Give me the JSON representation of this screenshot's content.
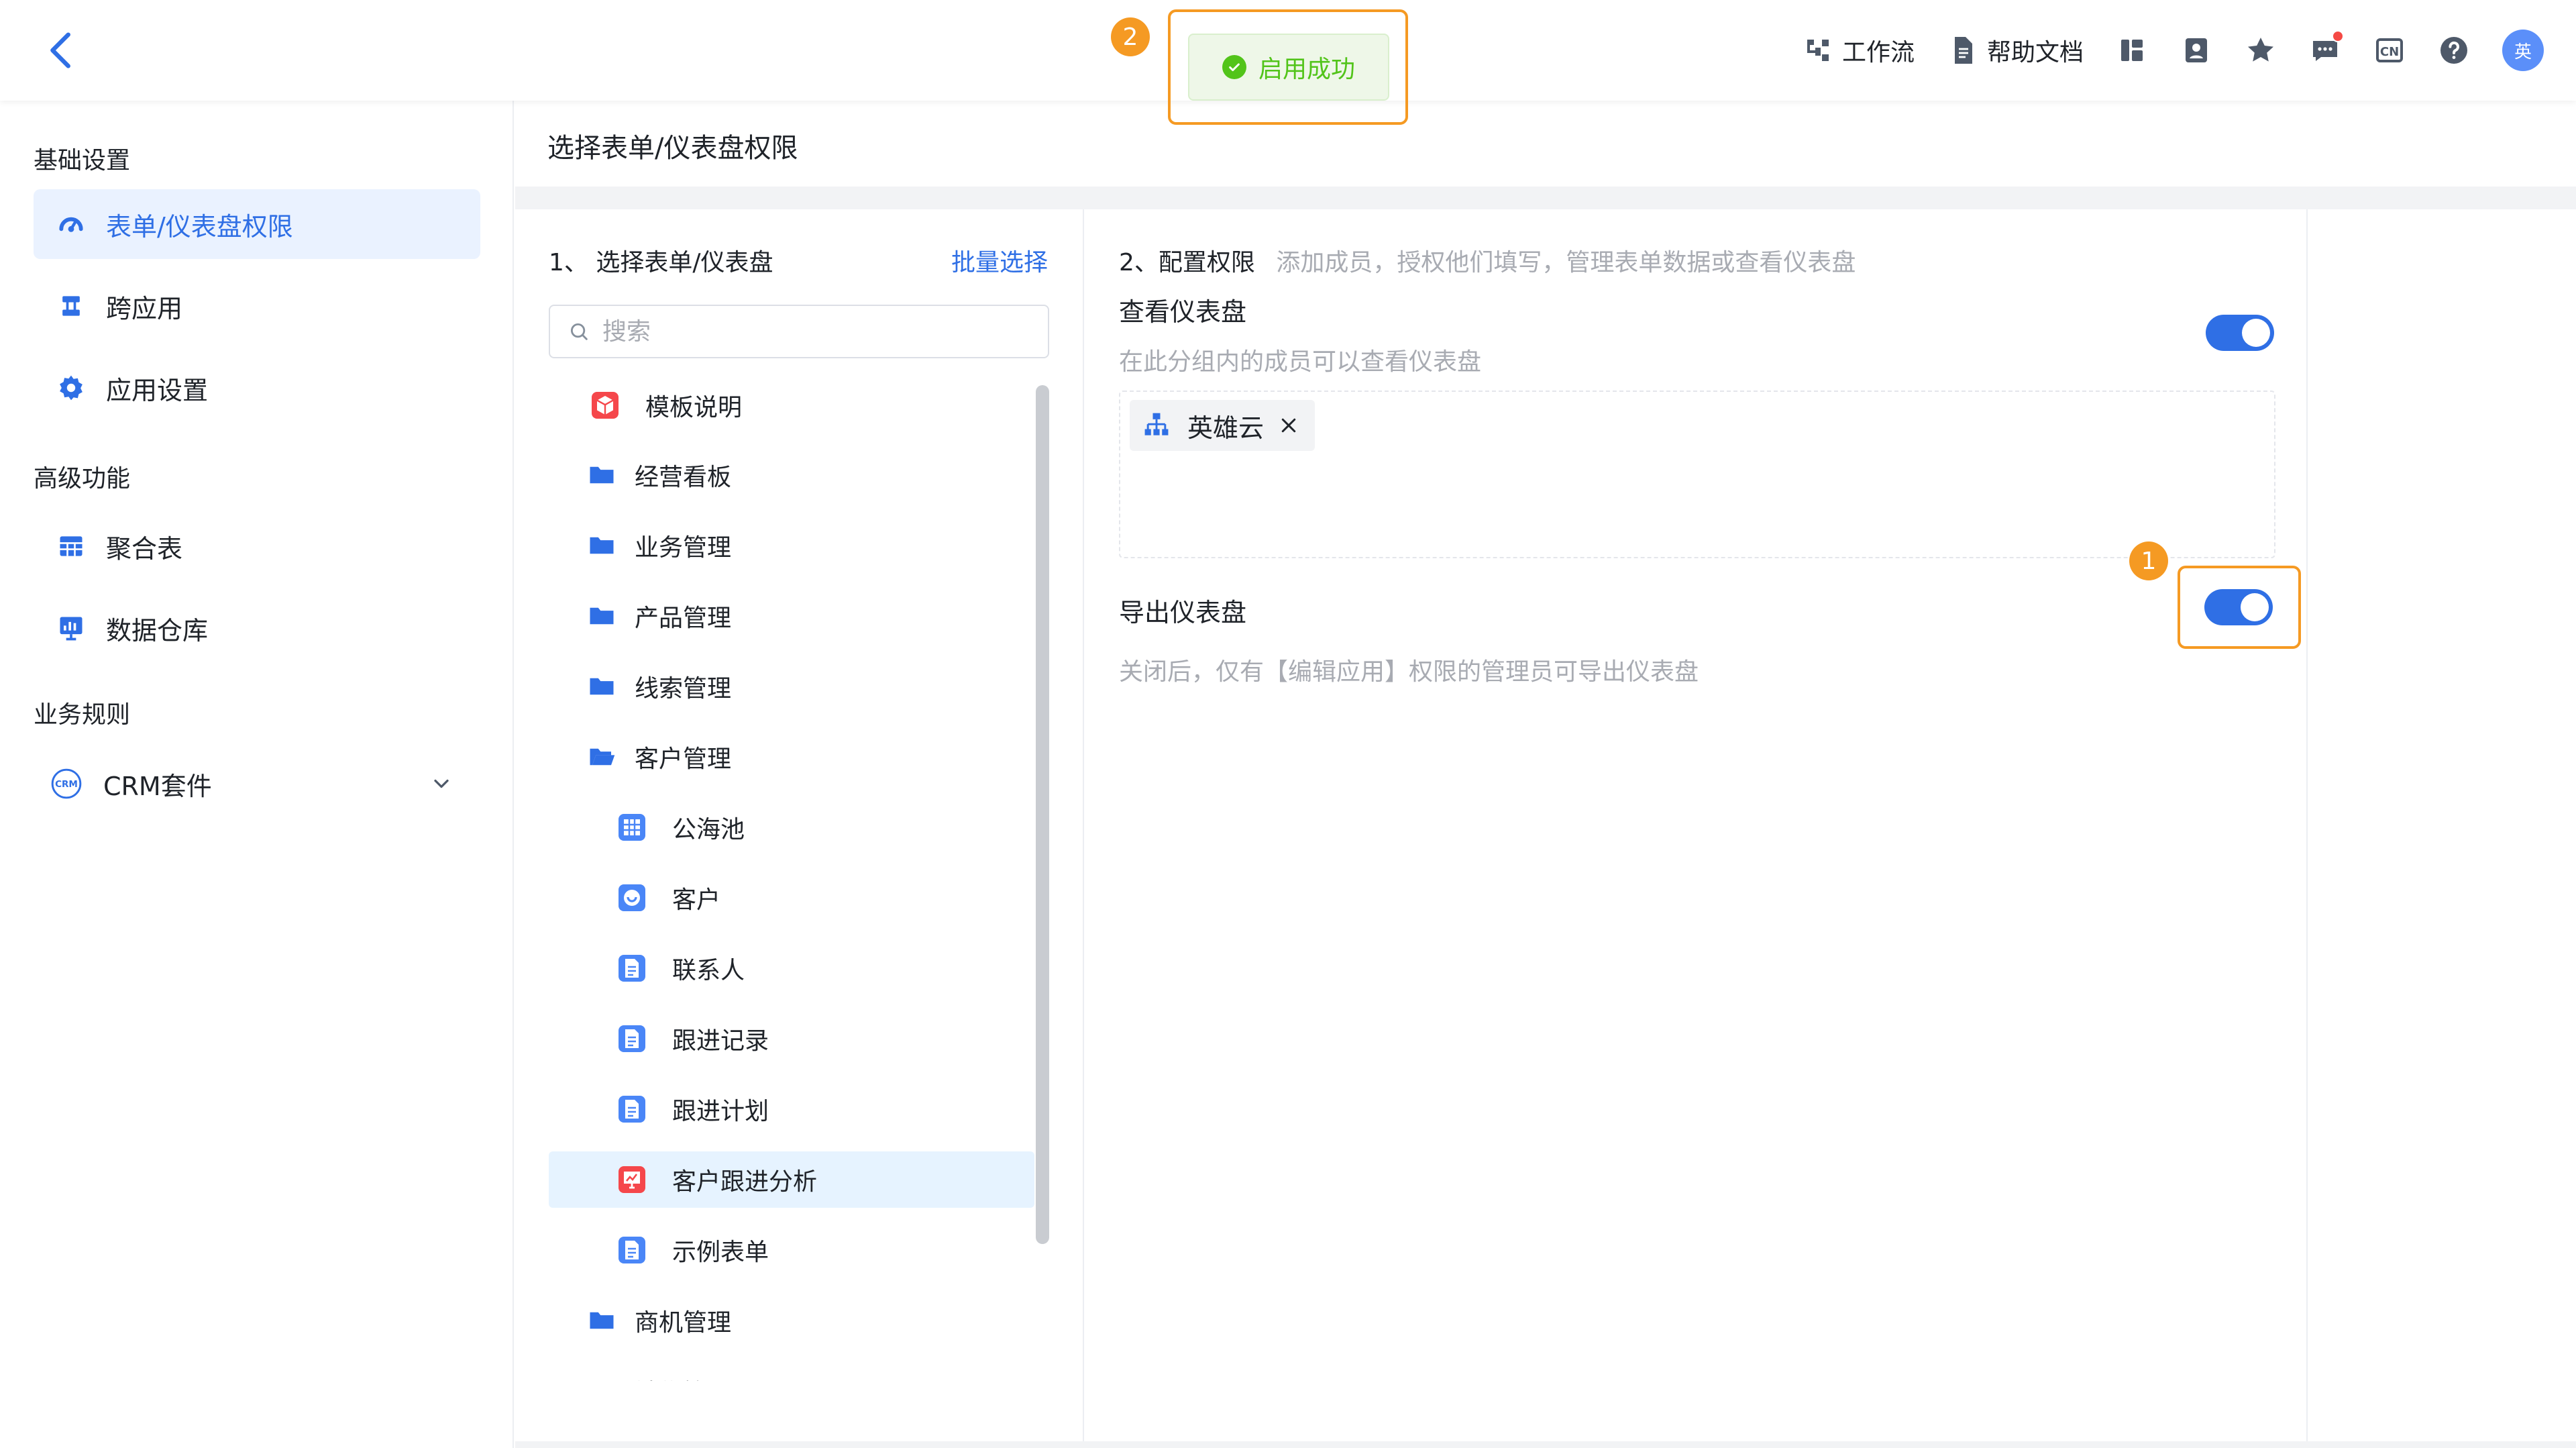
{
  "topbar": {
    "actions": [
      {
        "label": "工作流",
        "icon": "workflow-icon"
      },
      {
        "label": "帮助文档",
        "icon": "document-icon"
      },
      {
        "label": "",
        "icon": "layout-icon"
      },
      {
        "label": "",
        "icon": "contacts-icon"
      },
      {
        "label": "",
        "icon": "star-icon"
      },
      {
        "label": "",
        "icon": "message-icon"
      },
      {
        "label": "",
        "icon": "language-cn-icon"
      },
      {
        "label": "",
        "icon": "help-icon"
      }
    ],
    "avatar_text": "英",
    "lang_text": "CN"
  },
  "toast": {
    "message": "启用成功",
    "badge": "2"
  },
  "sidebar": {
    "groups": [
      {
        "title": "基础设置",
        "items": [
          {
            "label": "表单/仪表盘权限",
            "icon": "dashboard-permission-icon",
            "active": true
          },
          {
            "label": "跨应用",
            "icon": "cross-app-icon"
          },
          {
            "label": "应用设置",
            "icon": "gear-icon"
          }
        ]
      },
      {
        "title": "高级功能",
        "items": [
          {
            "label": "聚合表",
            "icon": "table-icon"
          },
          {
            "label": "数据仓库",
            "icon": "data-warehouse-icon"
          }
        ]
      },
      {
        "title": "业务规则",
        "items": [
          {
            "label": "CRM套件",
            "icon": "crm-icon"
          }
        ]
      }
    ]
  },
  "main": {
    "title": "选择表单/仪表盘权限",
    "left": {
      "title": "1、 选择表单/仪表盘",
      "batch_link": "批量选择",
      "search_placeholder": "搜索",
      "tree": [
        {
          "label": "模板说明",
          "type": "template"
        },
        {
          "label": "经营看板",
          "type": "folder"
        },
        {
          "label": "业务管理",
          "type": "folder"
        },
        {
          "label": "产品管理",
          "type": "folder"
        },
        {
          "label": "线索管理",
          "type": "folder"
        },
        {
          "label": "客户管理",
          "type": "folder-open"
        },
        {
          "label": "公海池",
          "type": "table"
        },
        {
          "label": "客户",
          "type": "customer"
        },
        {
          "label": "联系人",
          "type": "form"
        },
        {
          "label": "跟进记录",
          "type": "form"
        },
        {
          "label": "跟进计划",
          "type": "form"
        },
        {
          "label": "客户跟进分析",
          "type": "dashboard",
          "selected": true
        },
        {
          "label": "示例表单",
          "type": "form"
        },
        {
          "label": "商机管理",
          "type": "folder"
        },
        {
          "label": "销售管理",
          "type": "folder"
        }
      ]
    },
    "right": {
      "title": "2、配置权限",
      "subtitle": "添加成员，授权他们填写，管理表单数据或查看仪表盘",
      "view": {
        "label": "查看仪表盘",
        "desc": "在此分组内的成员可以查看仪表盘",
        "enabled": true,
        "members": [
          {
            "name": "英雄云",
            "icon": "org-icon"
          }
        ]
      },
      "export": {
        "label": "导出仪表盘",
        "desc": "关闭后，仅有【编辑应用】权限的管理员可导出仪表盘",
        "enabled": true,
        "badge": "1"
      }
    }
  },
  "colors": {
    "accent": "#2f6fe5",
    "highlight": "#f59a23",
    "success": "#52c41a"
  }
}
